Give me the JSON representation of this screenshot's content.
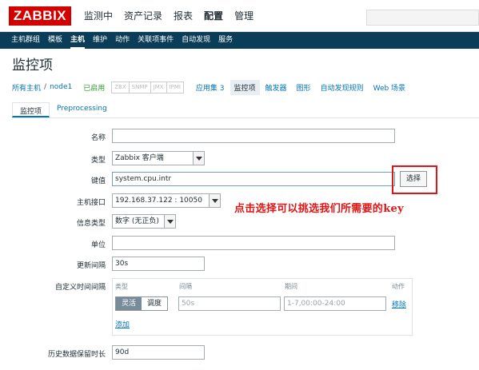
{
  "brand": {
    "logo": "ZABBIX"
  },
  "mainmenu": [
    "监测中",
    "资产记录",
    "报表",
    "配置",
    "管理"
  ],
  "submenu": [
    "主机群组",
    "模板",
    "主机",
    "维护",
    "动作",
    "关联项事件",
    "自动发现",
    "服务"
  ],
  "page_title": "监控项",
  "breadcrumb": {
    "all_hosts": "所有主机",
    "sep": "/",
    "host": "node1",
    "status": "已启用",
    "availability": [
      "ZBX",
      "SNMP",
      "JMX",
      "IPMI"
    ],
    "tabs": [
      "应用集 3",
      "监控项",
      "触发器",
      "图形",
      "自动发现规则",
      "Web 场景"
    ]
  },
  "tabs": [
    "监控项",
    "Preprocessing"
  ],
  "form": {
    "name_label": "名称",
    "name_value": "",
    "type_label": "类型",
    "type_value": "Zabbix 客户端",
    "key_label": "键值",
    "key_value": "system.cpu.intr",
    "select_button": "选择",
    "interface_label": "主机接口",
    "interface_value": "192.168.37.122 : 10050",
    "info_type_label": "信息类型",
    "info_type_value": "数字 (无正负)",
    "units_label": "单位",
    "units_value": "",
    "interval_label": "更新间隔",
    "interval_value": "30s",
    "custom_label": "自定义时间间隔",
    "history_label": "历史数据保留时长",
    "history_value": "90d"
  },
  "custom_intervals": {
    "headers": {
      "type": "类型",
      "interval": "间隔",
      "period": "期间",
      "action": "动作"
    },
    "seg_flexible": "灵活",
    "seg_scheduling": "调度",
    "interval_placeholder": "50s",
    "period_placeholder": "1-7,00:00-24:00",
    "remove": "移除",
    "add": "添加"
  },
  "annotation": "点击选择可以挑选我们所需要的key",
  "colors": {
    "brand_red": "#d40000",
    "nav_dark": "#0b3d58",
    "annotation_red": "#e21414",
    "link_blue": "#0275b8"
  }
}
